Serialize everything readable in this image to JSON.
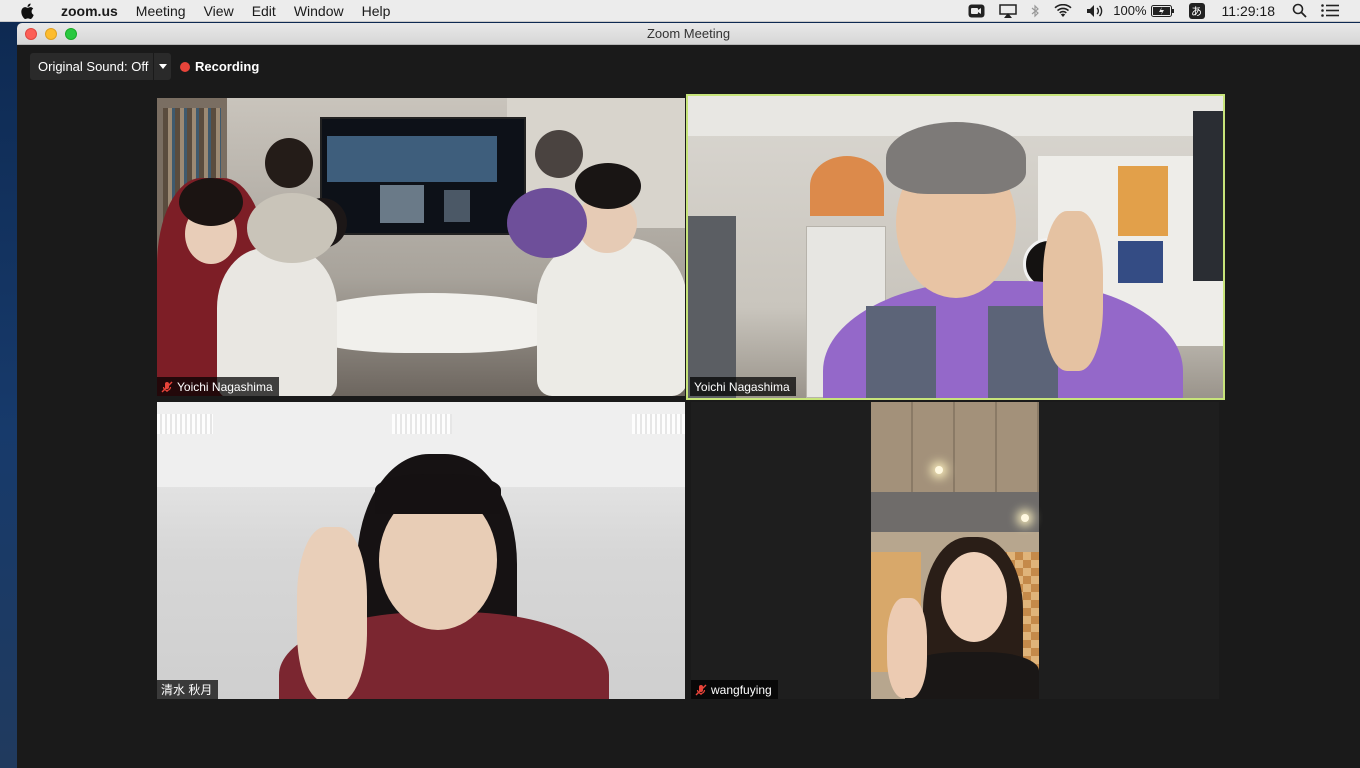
{
  "menubar": {
    "app_name": "zoom.us",
    "menus": [
      "Meeting",
      "View",
      "Edit",
      "Window",
      "Help"
    ],
    "battery": "100%",
    "input_method": "あ",
    "clock": "11:29:18"
  },
  "window": {
    "title": "Zoom Meeting"
  },
  "controls": {
    "original_sound": "Original Sound: Off",
    "recording": "Recording"
  },
  "participants": [
    {
      "name": "Yoichi Nagashima",
      "muted": true,
      "active_speaker": false
    },
    {
      "name": "Yoichi Nagashima",
      "muted": false,
      "active_speaker": true
    },
    {
      "name": "清水 秋月",
      "muted": false,
      "active_speaker": false
    },
    {
      "name": "wangfuying",
      "muted": true,
      "active_speaker": false
    }
  ],
  "colors": {
    "active_speaker_border": "#c7e47a",
    "recording_dot": "#e8443a",
    "mute_red": "#e8443a"
  }
}
